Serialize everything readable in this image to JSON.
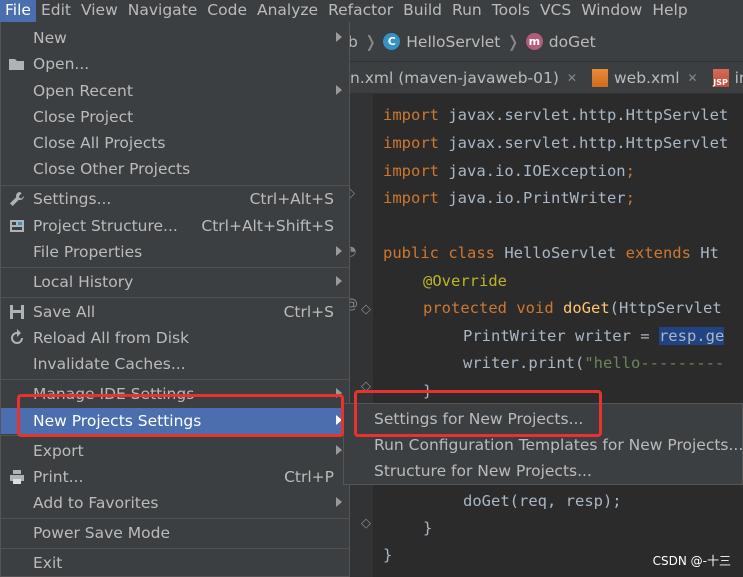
{
  "menubar": [
    "File",
    "Edit",
    "View",
    "Navigate",
    "Code",
    "Analyze",
    "Refactor",
    "Build",
    "Run",
    "Tools",
    "VCS",
    "Window",
    "Help"
  ],
  "breadcrumb": {
    "prefix": "b",
    "class_badge": "C",
    "class_name": "HelloServlet",
    "method_badge": "m",
    "method_name": "doGet"
  },
  "tabs": [
    {
      "label": "n.xml (maven-javaweb-01)",
      "close": "✕"
    },
    {
      "label": "web.xml",
      "close": "✕",
      "icon_text": ""
    },
    {
      "label": "ind",
      "icon_text": "JSP"
    }
  ],
  "code": {
    "l1_kw": "import",
    "l1_rest": " javax.servlet.http.HttpServlet",
    "l2_kw": "import",
    "l2_rest": " javax.servlet.http.HttpServlet",
    "l3_kw": "import",
    "l3_rest": " java.io.IOException",
    "l4_kw": "import",
    "l4_rest": " java.io.PrintWriter",
    "l5_kw1": "public class",
    "l5_mid": " HelloServlet ",
    "l5_kw2": "extends",
    "l5_rest": " Ht",
    "l6_anno": "@Override",
    "l7_kw": "protected void",
    "l7_fn": "doGet",
    "l7_rest": "(HttpServlet",
    "l8_pre": "PrintWriter writer = ",
    "l8_sel": "resp.ge",
    "l9_pre": "writer.print(",
    "l9_str": "\"hello---------",
    "l10": "}",
    "l11": "doGet(req, resp);",
    "l12": "}",
    "l13": "}",
    "semicolon": ";"
  },
  "file_menu": {
    "new": "New",
    "open": "Open...",
    "open_recent": "Open Recent",
    "close_project": "Close Project",
    "close_all": "Close All Projects",
    "close_other": "Close Other Projects",
    "settings": "Settings...",
    "settings_sc": "Ctrl+Alt+S",
    "project_structure": "Project Structure...",
    "project_structure_sc": "Ctrl+Alt+Shift+S",
    "file_properties": "File Properties",
    "local_history": "Local History",
    "save_all": "Save All",
    "save_all_sc": "Ctrl+S",
    "reload": "Reload All from Disk",
    "invalidate": "Invalidate Caches...",
    "manage_ide": "Manage IDE Settings",
    "new_projects_settings": "New Projects Settings",
    "export": "Export",
    "print": "Print...",
    "print_sc": "Ctrl+P",
    "add_favorites": "Add to Favorites",
    "power_save": "Power Save Mode",
    "exit": "Exit"
  },
  "submenu": {
    "settings_new": "Settings for New Projects...",
    "run_config": "Run Configuration Templates for New Projects...",
    "structure_new": "Structure for New Projects..."
  },
  "watermark": "CSDN @-十三",
  "colors": {
    "highlight": "#4b6eaf",
    "annotation_red": "#e8322e",
    "menu_bg": "#3c3f41",
    "editor_bg": "#2b2b2b"
  }
}
